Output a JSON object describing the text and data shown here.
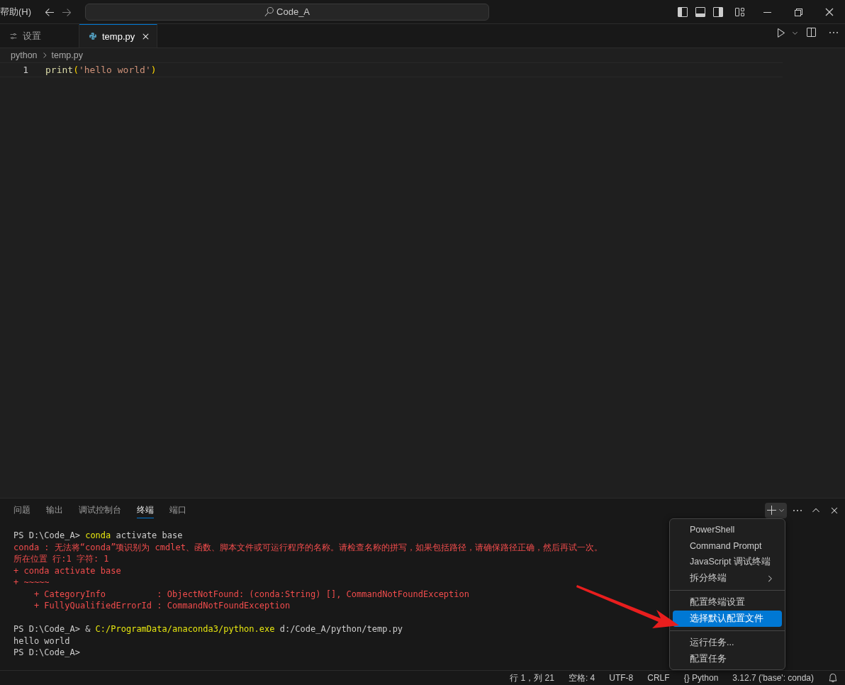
{
  "title_bar": {
    "menu_label": "帮助(H)",
    "search": "Code_A"
  },
  "tabs": [
    {
      "label": "设置",
      "kind": "settings",
      "selected": false
    },
    {
      "label": "temp.py",
      "kind": "python",
      "selected": true
    }
  ],
  "breadcrumb": [
    "python",
    "temp.py"
  ],
  "editor": {
    "lines": [
      {
        "number": "1",
        "tokens": [
          {
            "kind": "function",
            "text": "print"
          },
          {
            "kind": "bracket",
            "text": "("
          },
          {
            "kind": "string",
            "text": "'hello world'"
          },
          {
            "kind": "bracket",
            "text": ")"
          }
        ]
      }
    ]
  },
  "panel": {
    "tabs": [
      {
        "label": "问题",
        "selected": false
      },
      {
        "label": "输出",
        "selected": false
      },
      {
        "label": "调试控制台",
        "selected": false
      },
      {
        "label": "终端",
        "selected": true
      },
      {
        "label": "端口",
        "selected": false
      }
    ],
    "terminal_blocks": [
      [
        [
          {
            "kind": "plain",
            "text": "PS D:\\Code_A> "
          },
          {
            "kind": "highlight",
            "text": "conda"
          },
          {
            "kind": "plain",
            "text": " activate base"
          }
        ],
        [
          {
            "kind": "error",
            "text": "conda : 无法将“conda”项识别为 cmdlet、函数、脚本文件或可运行程序的名称。请检查名称的拼写，如果包括路径，请确保路径正确，然后再试一次。"
          }
        ],
        [
          {
            "kind": "error",
            "text": "所在位置 行:1 字符: 1"
          }
        ],
        [
          {
            "kind": "error",
            "text": "+ conda activate base"
          }
        ],
        [
          {
            "kind": "error",
            "text": "+ ~~~~~"
          }
        ],
        [
          {
            "kind": "error",
            "text": "    + CategoryInfo          : ObjectNotFound: (conda:String) [], CommandNotFoundException"
          }
        ],
        [
          {
            "kind": "error",
            "text": "    + FullyQualifiedErrorId : CommandNotFoundException"
          }
        ]
      ],
      [
        [
          {
            "kind": "plain",
            "text": "PS D:\\Code_A> & "
          },
          {
            "kind": "highlight",
            "text": "C:/ProgramData/anaconda3/python.exe"
          },
          {
            "kind": "plain",
            "text": " d:/Code_A/python/temp.py"
          }
        ],
        [
          {
            "kind": "plain",
            "text": "hello world"
          }
        ],
        [
          {
            "kind": "plain",
            "text": "PS D:\\Code_A>"
          }
        ]
      ]
    ]
  },
  "dropdown_menu": {
    "groups": [
      [
        {
          "label": "PowerShell",
          "selected": false,
          "submenu": false
        },
        {
          "label": "Command Prompt",
          "selected": false,
          "submenu": false
        },
        {
          "label": "JavaScript 调试终端",
          "selected": false,
          "submenu": false
        },
        {
          "label": "拆分终端",
          "selected": false,
          "submenu": true
        }
      ],
      [
        {
          "label": "配置终端设置",
          "selected": false,
          "submenu": false
        },
        {
          "label": "选择默认配置文件",
          "selected": true,
          "submenu": false
        }
      ],
      [
        {
          "label": "运行任务...",
          "selected": false,
          "submenu": false
        },
        {
          "label": "配置任务",
          "selected": false,
          "submenu": false
        }
      ]
    ]
  },
  "status_bar": [
    "行 1，列 21",
    "空格: 4",
    "UTF-8",
    "CRLF",
    "{} Python",
    "3.12.7 ('base': conda)"
  ]
}
